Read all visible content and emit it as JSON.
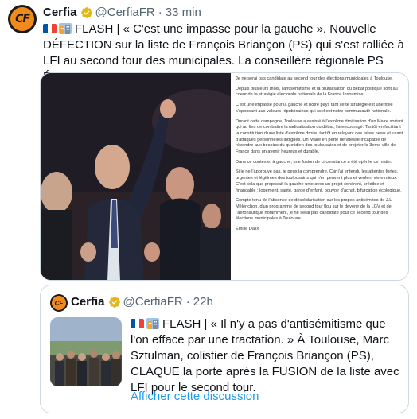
{
  "tweet": {
    "author_name": "Cerfia",
    "handle": "@CerfiaFR",
    "separator": "·",
    "time": "33 min",
    "avatar_initials": "CF",
    "text": "FLASH | « C'est une impasse pour la gauche ». Nouvelle DÉFECTION sur la liste de François Briançon (PS) qui s'est ralliée à LFI au second tour des municipales. La conseillère régionale PS Émilie Dalix REFUSE l'alliance.",
    "document_paragraphs": [
      "Je ne serai pas candidate au second tour des élections municipales à Toulouse.",
      "Depuis plusieurs mois, l'antisémitisme et la brutalisation du débat politique sont au coeur de la stratégie électorale nationale de la France Insoumise.",
      "C'est une impasse pour la gauche et notre pays tant cette stratégie est une folie s'opposant aux valeurs républicaines qui scellent notre communauté nationale.",
      "Durant cette campagne, Toulouse a assisté à l'extrême droitisation d'un Maire sortant qui au lieu de combattre la radicalisation du débat, l'a encouragé. Tantôt en facilitant la constitution d'une liste d'extrême droite, tantôt en relayant des fakes news et usant d'attaques personnelles indignes. Un Maire en perte de vitesse incapable de répondre aux besoins du quotidien des toulousains et de projeter la 3eme ville de France dans un avenir heureux et durable.",
      "Dans ce contexte, à gauche, une fusion de circonstance a été opérée ce matin.",
      "Si je ne l'approuve pas, je peux la comprendre. Car j'ai entendu les attentes fortes, urgentes et légitimes des toulousains qui n'en peuvent plus et veulent vivre mieux. C'est cela que proposait la gauche unie avec un projet cohérent, crédible et finançable : logement, santé, garde d'enfant, pouvoir d'achat, bifurcation écologique.",
      "Compte tenu de l'absence de désolidarisation sur les propos antisémites de J.L Mélenchon, d'un programme de second tour flou sur le devenir de la LGV et de l'aéronautique notamment, je ne serai pas candidate pour ce second tour des élections municipales à Toulouse.",
      "Émilie Dalix"
    ]
  },
  "quote": {
    "author_name": "Cerfia",
    "handle": "@CerfiaFR",
    "separator": "·",
    "time": "22h",
    "avatar_initials": "CF",
    "text": "FLASH | « Il n'y a pas d'antisémitisme que l'on efface par une tractation. » À Toulouse, Marc Sztulman, colistier de François Briançon (PS), CLAQUE la porte après la FUSION de la liste avec LFI pour le second tour.",
    "show_thread_label": "Afficher cette discussion"
  },
  "icons": {
    "verified": "verified-badge-icon",
    "flag": "france-flag-icon",
    "building": "city-building-icon"
  },
  "colors": {
    "accent_link": "#1d9bf0",
    "verified_gold": "#e2b719",
    "brand_orange": "#f08a1c",
    "muted_text": "#536471"
  }
}
